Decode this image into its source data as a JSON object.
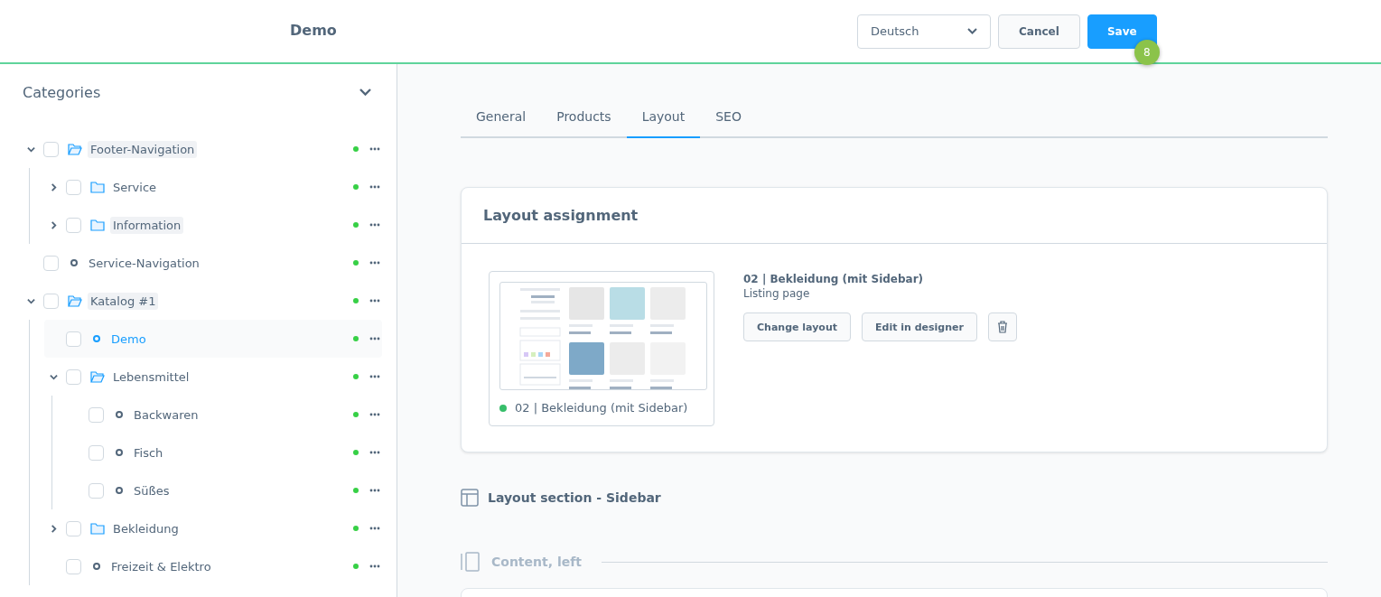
{
  "header": {
    "title": "Demo",
    "language": "Deutsch",
    "cancel": "Cancel",
    "save": "Save",
    "badge": "8"
  },
  "sidebar": {
    "title": "Categories",
    "tree": [
      {
        "kind": "folder",
        "label": "Footer-Navigation",
        "expanded": true,
        "checked": false,
        "selected": false,
        "highlighted": true,
        "children": [
          {
            "kind": "folder",
            "label": "Service",
            "expanded": false,
            "checked": false,
            "selected": false,
            "highlighted": false
          },
          {
            "kind": "folder",
            "label": "Information",
            "expanded": false,
            "checked": false,
            "selected": false,
            "highlighted": true
          }
        ]
      },
      {
        "kind": "page",
        "label": "Service-Navigation",
        "checked": false,
        "selected": false,
        "highlighted": false
      },
      {
        "kind": "folder",
        "label": "Katalog #1",
        "expanded": true,
        "checked": false,
        "selected": false,
        "highlighted": true,
        "children": [
          {
            "kind": "page",
            "label": "Demo",
            "checked": false,
            "selected": true,
            "highlighted": false
          },
          {
            "kind": "folder",
            "label": "Lebensmittel",
            "expanded": true,
            "checked": false,
            "selected": false,
            "highlighted": false,
            "children": [
              {
                "kind": "page",
                "label": "Backwaren",
                "checked": false,
                "selected": false,
                "highlighted": false
              },
              {
                "kind": "page",
                "label": "Fisch",
                "checked": false,
                "selected": false,
                "highlighted": false
              },
              {
                "kind": "page",
                "label": "Süßes",
                "checked": false,
                "selected": false,
                "highlighted": false
              }
            ]
          },
          {
            "kind": "folder",
            "label": "Bekleidung",
            "expanded": false,
            "checked": false,
            "selected": false,
            "highlighted": false
          },
          {
            "kind": "page",
            "label": "Freizeit & Elektro",
            "checked": false,
            "selected": false,
            "highlighted": false
          }
        ]
      }
    ]
  },
  "tabs": [
    {
      "label": "General",
      "selected": false
    },
    {
      "label": "Products",
      "selected": false
    },
    {
      "label": "Layout",
      "selected": true
    },
    {
      "label": "SEO",
      "selected": false
    }
  ],
  "layout_assignment": {
    "title": "Layout assignment",
    "preview_caption": "02 | Bekleidung (mit Sidebar)",
    "layout_name": "02 | Bekleidung (mit Sidebar)",
    "layout_type": "Listing page",
    "change_button": "Change layout",
    "edit_button": "Edit in designer"
  },
  "section": {
    "title": "Layout section - Sidebar",
    "block_title": "Content, left"
  }
}
